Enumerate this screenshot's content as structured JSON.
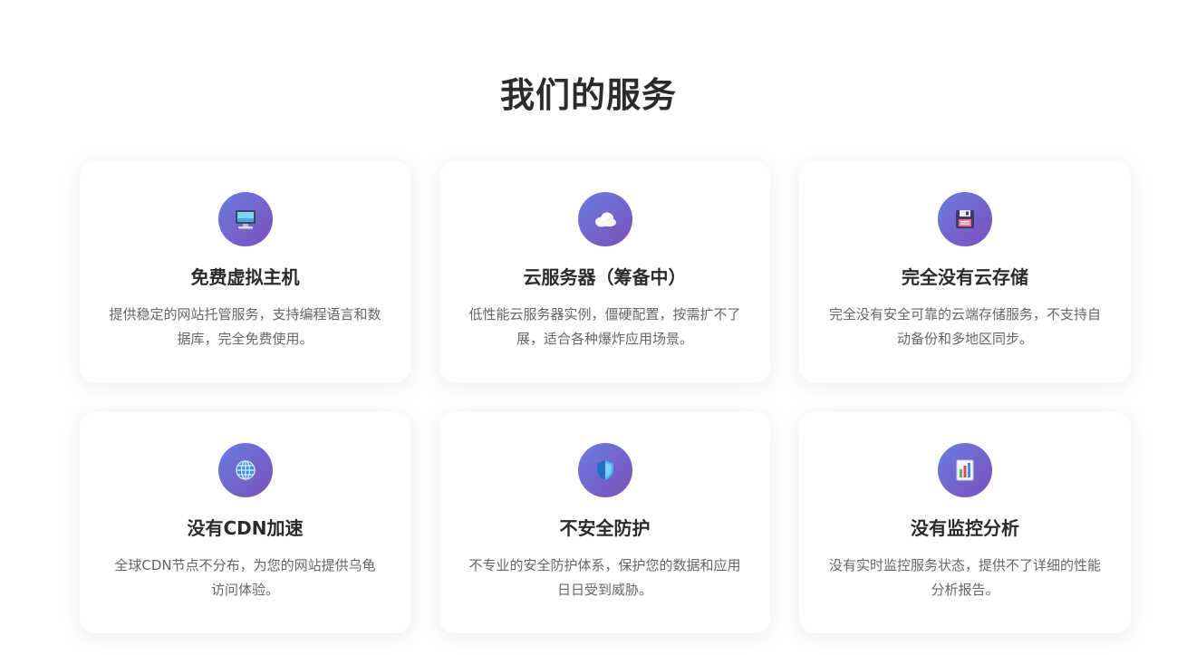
{
  "section": {
    "title": "我们的服务"
  },
  "services": [
    {
      "icon": "monitor-icon",
      "title": "免费虚拟主机",
      "description": "提供稳定的网站托管服务，支持编程语言和数据库，完全免费使用。"
    },
    {
      "icon": "cloud-icon",
      "title": "云服务器（筹备中）",
      "description": "低性能云服务器实例，僵硬配置，按需扩不了展，适合各种爆炸应用场景。"
    },
    {
      "icon": "floppy-disk-icon",
      "title": "完全没有云存储",
      "description": "完全没有安全可靠的云端存储服务，不支持自动备份和多地区同步。"
    },
    {
      "icon": "globe-icon",
      "title": "没有CDN加速",
      "description": "全球CDN节点不分布，为您的网站提供乌龟访问体验。"
    },
    {
      "icon": "shield-icon",
      "title": "不安全防护",
      "description": "不专业的安全防护体系，保护您的数据和应用日日受到威胁。"
    },
    {
      "icon": "bar-chart-icon",
      "title": "没有监控分析",
      "description": "没有实时监控服务状态，提供不了详细的性能分析报告。"
    }
  ],
  "colors": {
    "icon_gradient_start": "#6a7de3",
    "icon_gradient_end": "#7b4fb8",
    "title_text": "#2b2b2b",
    "description_text": "#666666",
    "card_background": "#ffffff"
  }
}
